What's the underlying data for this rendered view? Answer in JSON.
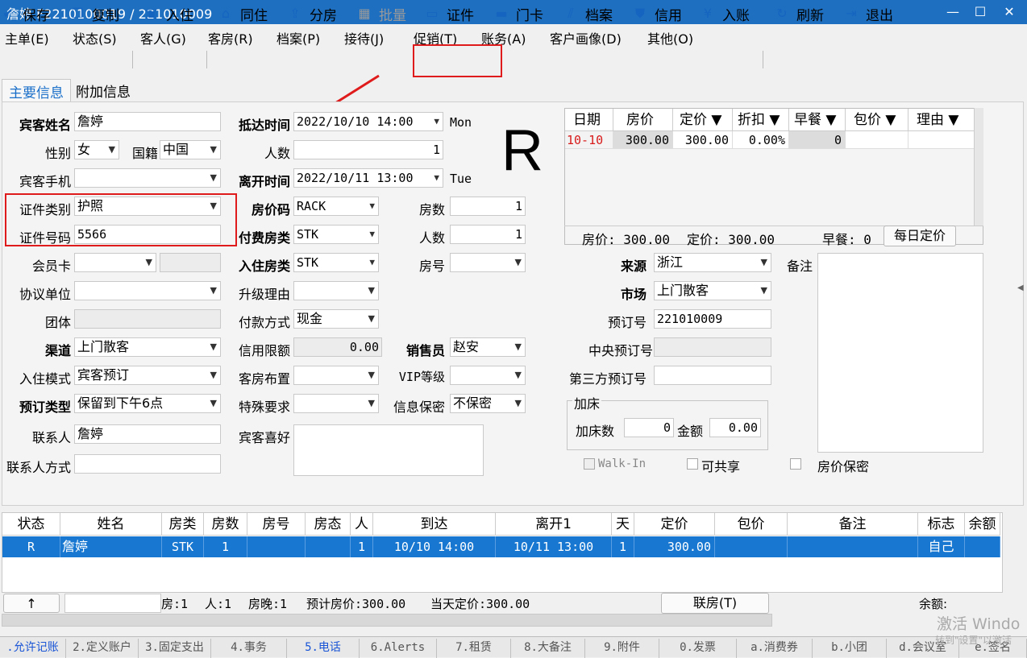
{
  "titlebar": {
    "title": "詹婷  F2210100019  /  221010009",
    "min": "—",
    "max": "☐",
    "close": "✕"
  },
  "menu": [
    "主单(E)",
    "状态(S)",
    "客人(G)",
    "客房(R)",
    "档案(P)",
    "接待(J)",
    "促销(T)",
    "账务(A)",
    "客户画像(D)",
    "其他(O)"
  ],
  "toolbar": {
    "save": "保存",
    "copy": "复制",
    "checkin": "入住",
    "same_room": "同住",
    "split_room": "分房",
    "batch": "批量",
    "id_card": "证件",
    "room_card": "门卡",
    "archive": "档案",
    "credit": "信用",
    "post": "入账",
    "refresh": "刷新",
    "exit": "退出"
  },
  "tabs": {
    "main": "主要信息",
    "extra": "附加信息"
  },
  "form": {
    "guest_name_label": "宾客姓名",
    "guest_name": "詹婷",
    "gender_label": "性别",
    "gender": "女",
    "nationality_label": "国籍",
    "nationality": "中国",
    "phone_label": "宾客手机",
    "phone": "",
    "id_type_label": "证件类别",
    "id_type": "护照",
    "id_no_label": "证件号码",
    "id_no": "5566",
    "member_label": "会员卡",
    "member": "",
    "agreement_label": "协议单位",
    "agreement": "",
    "group_label": "团体",
    "group": "",
    "channel_label": "渠道",
    "channel": "上门散客",
    "checkin_mode_label": "入住模式",
    "checkin_mode": "宾客预订",
    "booking_type_label": "预订类型",
    "booking_type": "保留到下午6点",
    "contact_label": "联系人",
    "contact": "詹婷",
    "contact_method_label": "联系人方式",
    "contact_method": "",
    "arrival_label": "抵达时间",
    "arrival": "2022/10/10 14:00",
    "arrival_dow": "Mon",
    "persons_label": "人数",
    "persons": "1",
    "departure_label": "离开时间",
    "departure": "2022/10/11 13:00",
    "departure_dow": "Tue",
    "rate_code_label": "房价码",
    "rate_code": "RACK",
    "rooms_label": "房数",
    "rooms": "1",
    "pay_room_type_label": "付费房类",
    "pay_room_type": "STK",
    "persons2_label": "人数",
    "persons2": "1",
    "room_type_label": "入住房类",
    "room_type": "STK",
    "room_no_label": "房号",
    "room_no": "",
    "upgrade_label": "升级理由",
    "upgrade": "",
    "pay_method_label": "付款方式",
    "pay_method": "现金",
    "credit_limit_label": "信用限额",
    "credit_limit": "0.00",
    "sales_label": "销售员",
    "sales": "赵安",
    "layout_label": "客房布置",
    "layout": "",
    "vip_label": "VIP等级",
    "vip": "",
    "special_label": "特殊要求",
    "special": "",
    "privacy_label": "信息保密",
    "privacy": "不保密",
    "preference_label": "宾客喜好",
    "preference": "",
    "source_label": "来源",
    "source": "浙江",
    "market_label": "市场",
    "market": "上门散客",
    "booking_no_label": "预订号",
    "booking_no": "221010009",
    "central_no_label": "中央预订号",
    "central_no": "",
    "third_no_label": "第三方预订号",
    "third_no": "",
    "remark_label": "备注",
    "extra_bed_title": "加床",
    "extra_bed_count_label": "加床数",
    "extra_bed_count": "0",
    "extra_bed_amount_label": "金额",
    "extra_bed_amount": "0.00",
    "walkin_label": "Walk-In",
    "shareable_label": "可共享",
    "rate_secret_label": "房价保密"
  },
  "big_letter": "R",
  "rate_grid": {
    "headers": [
      "日期",
      "房价",
      "定价 ▼",
      "折扣 ▼",
      "早餐 ▼",
      "包价 ▼",
      "理由 ▼"
    ],
    "row": [
      "10-10",
      "300.00",
      "300.00",
      "0.00%",
      "0",
      "",
      ""
    ],
    "footer_rate": "房价: 300.00",
    "footer_fixed": "定价: 300.00",
    "footer_breakfast": "早餐: 0",
    "daily_btn": "每日定价"
  },
  "grid": {
    "headers": [
      "状态",
      "姓名",
      "房类",
      "房数",
      "房号",
      "房态",
      "人",
      "到达",
      "离开1",
      "天",
      "定价",
      "包价",
      "备注",
      "标志",
      "余额"
    ],
    "row": [
      "R",
      "詹婷",
      "STK",
      "1",
      "",
      "",
      "1",
      "10/10 14:00",
      "10/11 13:00",
      "1",
      "300.00",
      "",
      "",
      "自己",
      ""
    ]
  },
  "status": {
    "up_btn": "↑",
    "rooms": "房:1",
    "persons": "人:1",
    "nights": "房晚:1",
    "est": "预计房价:300.00",
    "today": "当天定价:300.00",
    "link_btn": "联房(T)",
    "balance": "余额:"
  },
  "bottom_tabs": [
    ".允许记账",
    "2.定义账户",
    "3.固定支出",
    "4.事务",
    "5.电话",
    "6.Alerts",
    "7.租赁",
    "8.大备注",
    "9.附件",
    "0.发票",
    "a.消费券",
    "b.小团",
    "d.会议室",
    "e.签名"
  ],
  "watermark": "激活 Windo",
  "watermark2": "转到\"设置\"以激活"
}
